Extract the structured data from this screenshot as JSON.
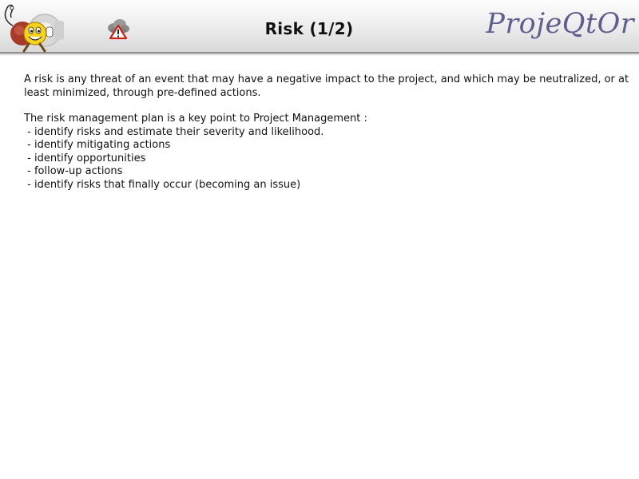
{
  "header": {
    "title": "Risk (1/2)",
    "brand": "ProjeQtOr",
    "mascot_icon": "mascot-logo-icon",
    "topic_icon": "risk-warning-icon",
    "brand_color": "#5e5f8e"
  },
  "content": {
    "intro": "A risk is any threat of an event that may have a negative impact to the project, and which may be neutralized, or at least minimized, through pre-defined actions.",
    "plan_heading": "The risk management plan is a key point to Project Management :",
    "items": [
      " - identify risks and estimate their severity and likelihood.",
      " - identify mitigating actions",
      " - identify opportunities",
      " - follow-up actions",
      " - identify risks that finally occur (becoming an issue)"
    ]
  }
}
